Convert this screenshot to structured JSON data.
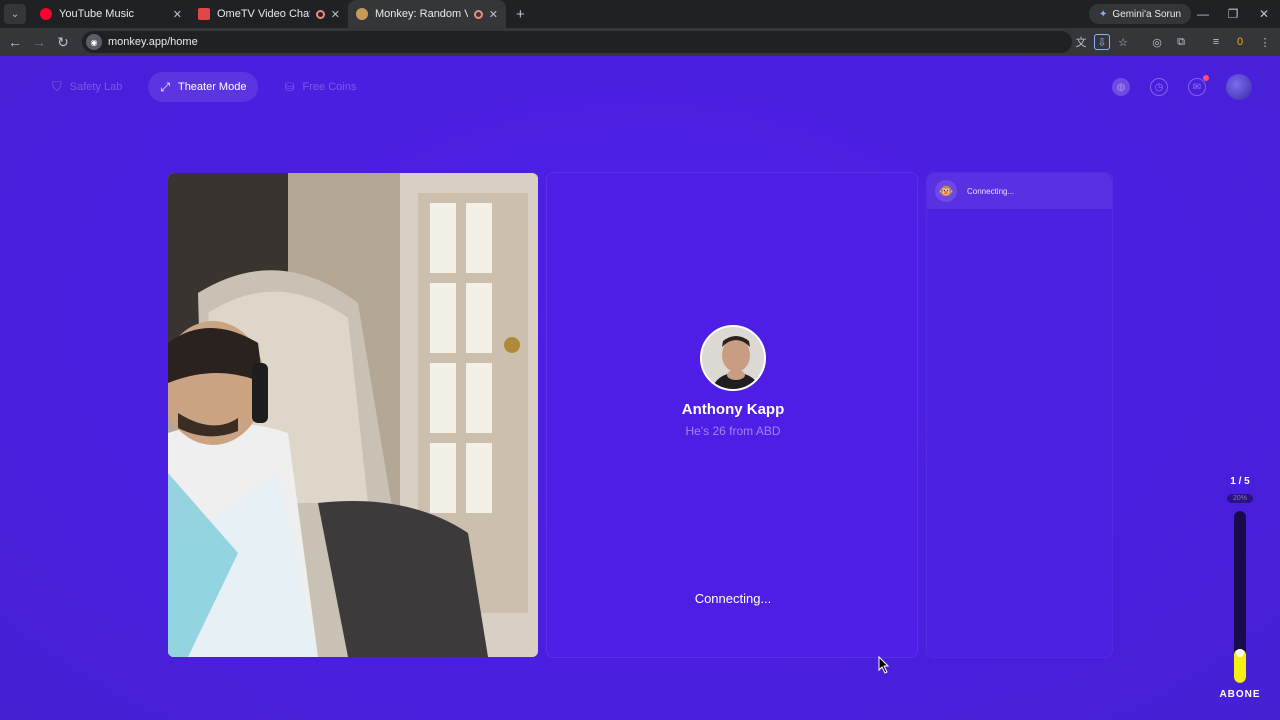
{
  "browser": {
    "tabs": [
      {
        "title": "YouTube Music",
        "favicon_color": "#ff0033",
        "recording": false
      },
      {
        "title": "OmeTV Video Chat — Ome",
        "favicon_color": "#e04848",
        "recording": true
      },
      {
        "title": "Monkey: Random Video Ch",
        "favicon_color": "#c89a5a",
        "recording": true,
        "active": true
      }
    ],
    "gemini_label": "Gemini'a Sorun",
    "url": "monkey.app/home",
    "badge_count": "0"
  },
  "nav": {
    "safety_lab": "Safety Lab",
    "theater_mode": "Theater Mode",
    "free_coins": "Free Coins"
  },
  "match": {
    "name": "Anthony Kapp",
    "info": "He's 26 from ABD",
    "status": "Connecting..."
  },
  "chat": {
    "status": "Connecting..."
  },
  "progress": {
    "step": "1 / 5",
    "percent_label": "20%",
    "fill_fraction": 0.2,
    "label": "ABONE"
  },
  "colors": {
    "page_bg": "#4a1fe0",
    "progress_fill": "#f5ef12"
  }
}
